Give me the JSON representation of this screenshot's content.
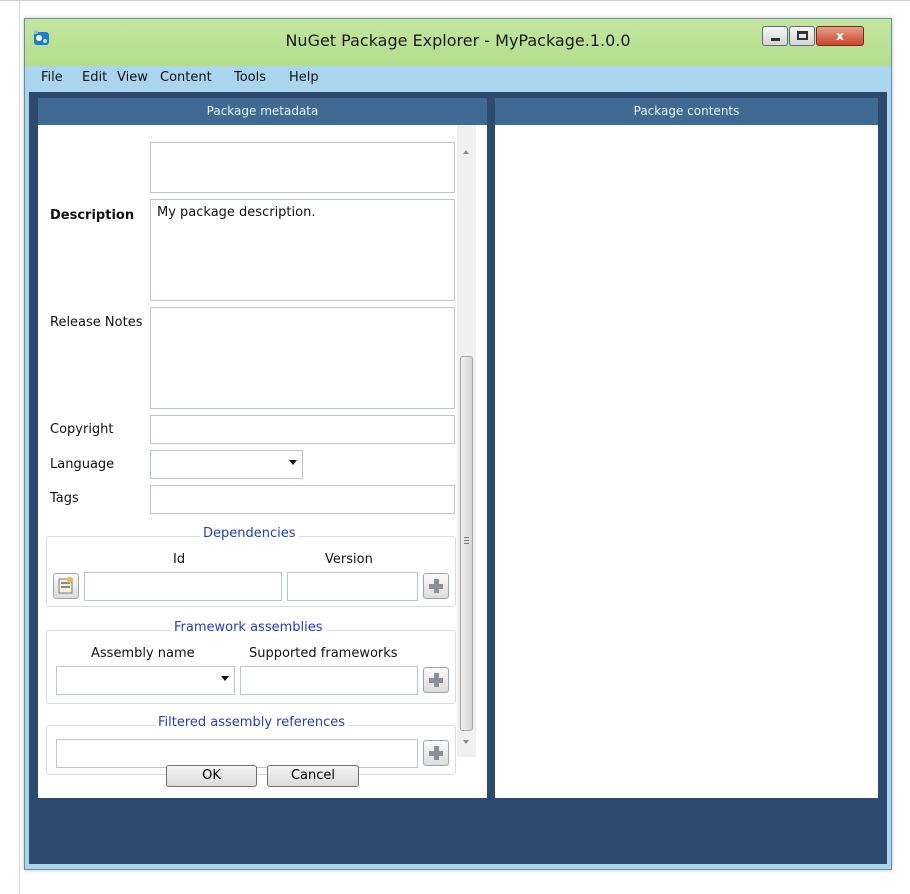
{
  "window": {
    "title": "NuGet Package Explorer - MyPackage.1.0.0",
    "close_glyph": "x"
  },
  "menu": [
    "File",
    "Edit",
    "View",
    "Content",
    "Tools",
    "Help"
  ],
  "panels": {
    "left_title": "Package metadata",
    "right_title": "Package contents"
  },
  "form": {
    "description_label": "Description",
    "description_value": "My package description.",
    "release_notes_label": "Release Notes",
    "release_notes_value": "",
    "copyright_label": "Copyright",
    "copyright_value": "",
    "language_label": "Language",
    "language_value": "",
    "tags_label": "Tags",
    "tags_value": ""
  },
  "dependencies": {
    "title": "Dependencies",
    "id_header": "Id",
    "version_header": "Version"
  },
  "framework": {
    "title": "Framework assemblies",
    "assembly_header": "Assembly name",
    "frameworks_header": "Supported frameworks"
  },
  "filtered": {
    "title": "Filtered assembly references"
  },
  "buttons": {
    "ok": "OK",
    "cancel": "Cancel"
  },
  "colors": {
    "titlebar": "#b3dd8a",
    "panel_header": "#3f6a93",
    "group_title": "#1f3fc4",
    "client_bg": "#2b4a6e"
  }
}
